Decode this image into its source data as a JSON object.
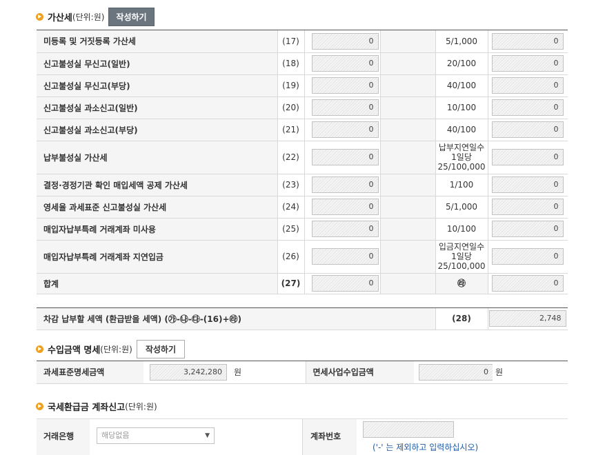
{
  "penalty": {
    "title": "가산세",
    "unit": "(단위:원)",
    "write_button": "작성하기",
    "rows": [
      {
        "label": "미등록 및 거짓등록 가산세",
        "no": "(17)",
        "base": "0",
        "rate": "5/1,000",
        "amount": "0"
      },
      {
        "label": "신고불성실 무신고(일반)",
        "no": "(18)",
        "base": "0",
        "rate": "20/100",
        "amount": "0"
      },
      {
        "label": "신고불성실 무신고(부당)",
        "no": "(19)",
        "base": "0",
        "rate": "40/100",
        "amount": "0"
      },
      {
        "label": "신고불성실 과소신고(일반)",
        "no": "(20)",
        "base": "0",
        "rate": "10/100",
        "amount": "0"
      },
      {
        "label": "신고불성실 과소신고(부당)",
        "no": "(21)",
        "base": "0",
        "rate": "40/100",
        "amount": "0"
      },
      {
        "label": "납부불성실 가산세",
        "no": "(22)",
        "base": "0",
        "rate": "납부지연일수\n1일당\n25/100,000",
        "amount": "0"
      },
      {
        "label": "결정·경정기관 확인 매입세액 공제 가산세",
        "no": "(23)",
        "base": "0",
        "rate": "1/100",
        "amount": "0"
      },
      {
        "label": "영세율 과세표준 신고불성실 가산세",
        "no": "(24)",
        "base": "0",
        "rate": "5/1,000",
        "amount": "0"
      },
      {
        "label": "매입자납부특례 거래계좌 미사용",
        "no": "(25)",
        "base": "0",
        "rate": "10/100",
        "amount": "0"
      },
      {
        "label": "매입자납부특례 거래계좌 지연입금",
        "no": "(26)",
        "base": "0",
        "rate": "입금지연일수\n1일당\n25/100,000",
        "amount": "0"
      }
    ],
    "total": {
      "label": "합계",
      "no": "(27)",
      "base": "0",
      "rate": "㉱",
      "amount": "0"
    }
  },
  "deduct": {
    "label": "차감 납부할 세액 (환급받을 세액) (㉮-㉯-㉰-(16)+㉱)",
    "no": "(28)",
    "amount": "2,748"
  },
  "income": {
    "title": "수입금액 명세",
    "unit": "(단위:원)",
    "write_button": "작성하기",
    "taxbase_label": "과세표준명세금액",
    "taxbase_value": "3,242,280",
    "exempt_label": "면세사업수입금액",
    "exempt_value": "0",
    "won": "원"
  },
  "refund": {
    "title": "국세환급금 계좌신고",
    "unit": "(단위:원)",
    "bank_label": "거래은행",
    "bank_selected": "해당없음",
    "account_label": "계좌번호",
    "account_value": "",
    "note": "('-' 는 제외하고 입력하십시오)"
  }
}
